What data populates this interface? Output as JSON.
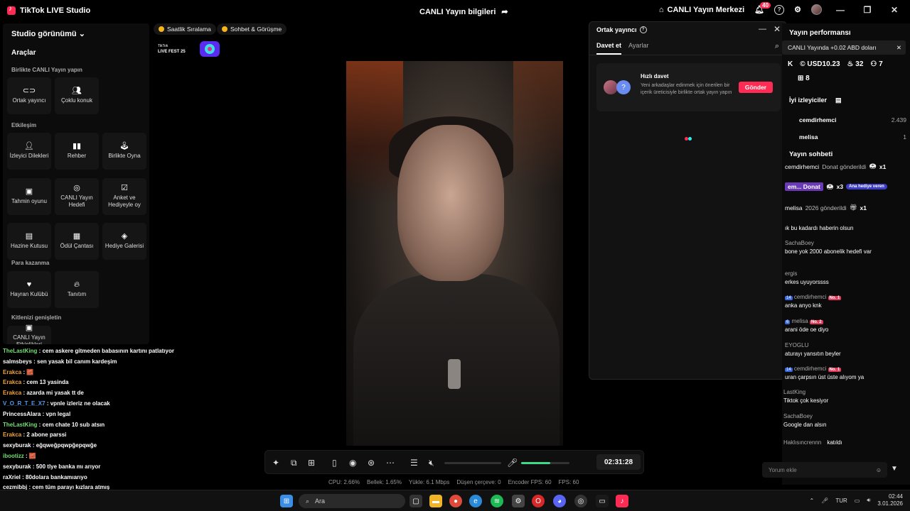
{
  "app": {
    "title": "TikTok LIVE Studio",
    "center_title": "CANLI Yayın bilgileri",
    "live_center": "CANLI Yayın Merkezi",
    "notif_count": "40"
  },
  "left": {
    "studio_view": "Studio görünümü",
    "tools_heading": "Araçlar",
    "sections": {
      "together": "Birlikte CANLI Yayın yapın",
      "interaction": "Etkileşim",
      "earn": "Para kazanma",
      "expand": "Kitlenizi genişletin"
    },
    "tiles": {
      "cohost": "Ortak yayıncı",
      "multi": "Çoklu konuk",
      "requests": "İzleyici Dilekleri",
      "guide": "Rehber",
      "play": "Birlikte Oyna",
      "guess": "Tahmin oyunu",
      "goal": "CANLI Yayın Hedefi",
      "poll": "Anket ve Hediyeyle oy",
      "treasure": "Hazine Kutusu",
      "prize": "Ödül Çantası",
      "gallery": "Hediye Galerisi",
      "fanclub": "Hayran Kulübü",
      "promo": "Tanıtım",
      "events": "CANLI Yayın Etkinlikleri"
    }
  },
  "chips": {
    "hourly": "Saatlik Sıralama",
    "chat": "Sohbet & Görüşme"
  },
  "fest": "TikTok LIVE FEST 25",
  "popup": {
    "title": "Ortak yayıncı",
    "tab_invite": "Davet et",
    "tab_settings": "Ayarlar",
    "quick_invite": "Hızlı davet",
    "desc": "Yeni arkadaşlar edinmek için önerilen bir içerik üreticisiyle birlikte ortak yayın yapın",
    "send": "Gönder"
  },
  "right": {
    "perf": "Yayın performansı",
    "notice": "CANLI Yayında +0.02 ABD doları",
    "stats": {
      "k": "K",
      "usd": "USD10.23",
      "fire": "32",
      "users": "7",
      "gifts": "8"
    },
    "best_viewers": "İyi izleyiciler",
    "viewers": [
      {
        "name": "cemdirhemci",
        "score": "2.439"
      },
      {
        "name": "melisa",
        "score": "1"
      }
    ],
    "chat_title": "Yayın sohbeti",
    "pinned": [
      {
        "user": "cemdirhemci",
        "text": "Donat gönderildi",
        "count": "x1"
      },
      {
        "user": "em...",
        "text": "Donat",
        "count": "x3",
        "badge": "Ana hediye veren"
      },
      {
        "user": "melisa",
        "text": "2026 gönderildi",
        "count": "x1"
      }
    ],
    "messages": [
      {
        "user": "",
        "text": "ık bu kadardı haberin olsun"
      },
      {
        "user": "SachaBoey",
        "text": "bone yok 2000 abonelik hedefi var"
      },
      {
        "user": "ergis",
        "text": "erkes uyuyorssss"
      },
      {
        "user": "cemdirhemci",
        "level": "14",
        "rank": "No. 1",
        "text": "anka anyo knk"
      },
      {
        "user": "melisa",
        "level": "6",
        "rank": "No. 2",
        "text": "arani öde oe diyo"
      },
      {
        "user": "EYOGLU",
        "text": "aturayı yansıtın beyler"
      },
      {
        "user": "cemdirhemci",
        "level": "14",
        "rank": "No. 1",
        "text": "uran çarpsın üst üste alıyom ya"
      },
      {
        "user": "LastKing",
        "text": "Tiktok çok kesiyor"
      },
      {
        "user": "SachaBoey",
        "text": "Google dan alsın"
      },
      {
        "user": "Haklısıncrennn",
        "text": "katıldı"
      }
    ],
    "comment_placeholder": "Yorum ekle"
  },
  "controls": {
    "timer": "02:31:28",
    "mic_level": 0.6
  },
  "status": {
    "cpu": "CPU: 2.66%",
    "mem": "Bellek: 1.65%",
    "upload": "Yükle: 6.1 Mbps",
    "dropped": "Düşen çerçeve: 0",
    "encoder": "Encoder FPS: 60",
    "fps": "FPS: 60"
  },
  "leftchat": [
    {
      "user": "TheLastKing",
      "text": " : cem askere gitmeden babasının kartını patlatıyor",
      "cls": "g"
    },
    {
      "user": "salmsbeys",
      "text": " : sen yasak bil canım kardeşim",
      "cls": ""
    },
    {
      "user": "Erakca",
      "text": " : 🧱",
      "cls": "u"
    },
    {
      "user": "Erakca",
      "text": " : cem 13 yasinda",
      "cls": "u"
    },
    {
      "user": "Erakca",
      "text": " : azarda mi yasak tt de",
      "cls": "u"
    },
    {
      "user": "V_O_R_T_E_X7",
      "text": " : vpnle izleriz ne olacak",
      "cls": "b"
    },
    {
      "user": "PrincessAlara",
      "text": " : vpn legal",
      "cls": ""
    },
    {
      "user": "TheLastKing",
      "text": " : cem chate 10 sub atsın",
      "cls": "g"
    },
    {
      "user": "Erakca",
      "text": " : 2 abone parssi",
      "cls": "u"
    },
    {
      "user": "sexyburak",
      "text": " : eğqweğpqwpğepqwğe",
      "cls": ""
    },
    {
      "user": "ibootizz",
      "text": " : 🧱",
      "cls": "g"
    },
    {
      "user": "sexyburak",
      "text": " : 500 tlye banka mı arıyor",
      "cls": ""
    },
    {
      "user": "raXriel",
      "text": " : 80dolara bankamıarıyo",
      "cls": ""
    },
    {
      "user": "cezmibbj",
      "text": " : cem tüm parayı kızlara atmış",
      "cls": ""
    },
    {
      "user": "Erakca",
      "text": " : 3",
      "cls": "u"
    }
  ],
  "taskbar": {
    "search": "Ara",
    "lang": "TUR",
    "time": "02:44",
    "date": "3.01.2026"
  }
}
